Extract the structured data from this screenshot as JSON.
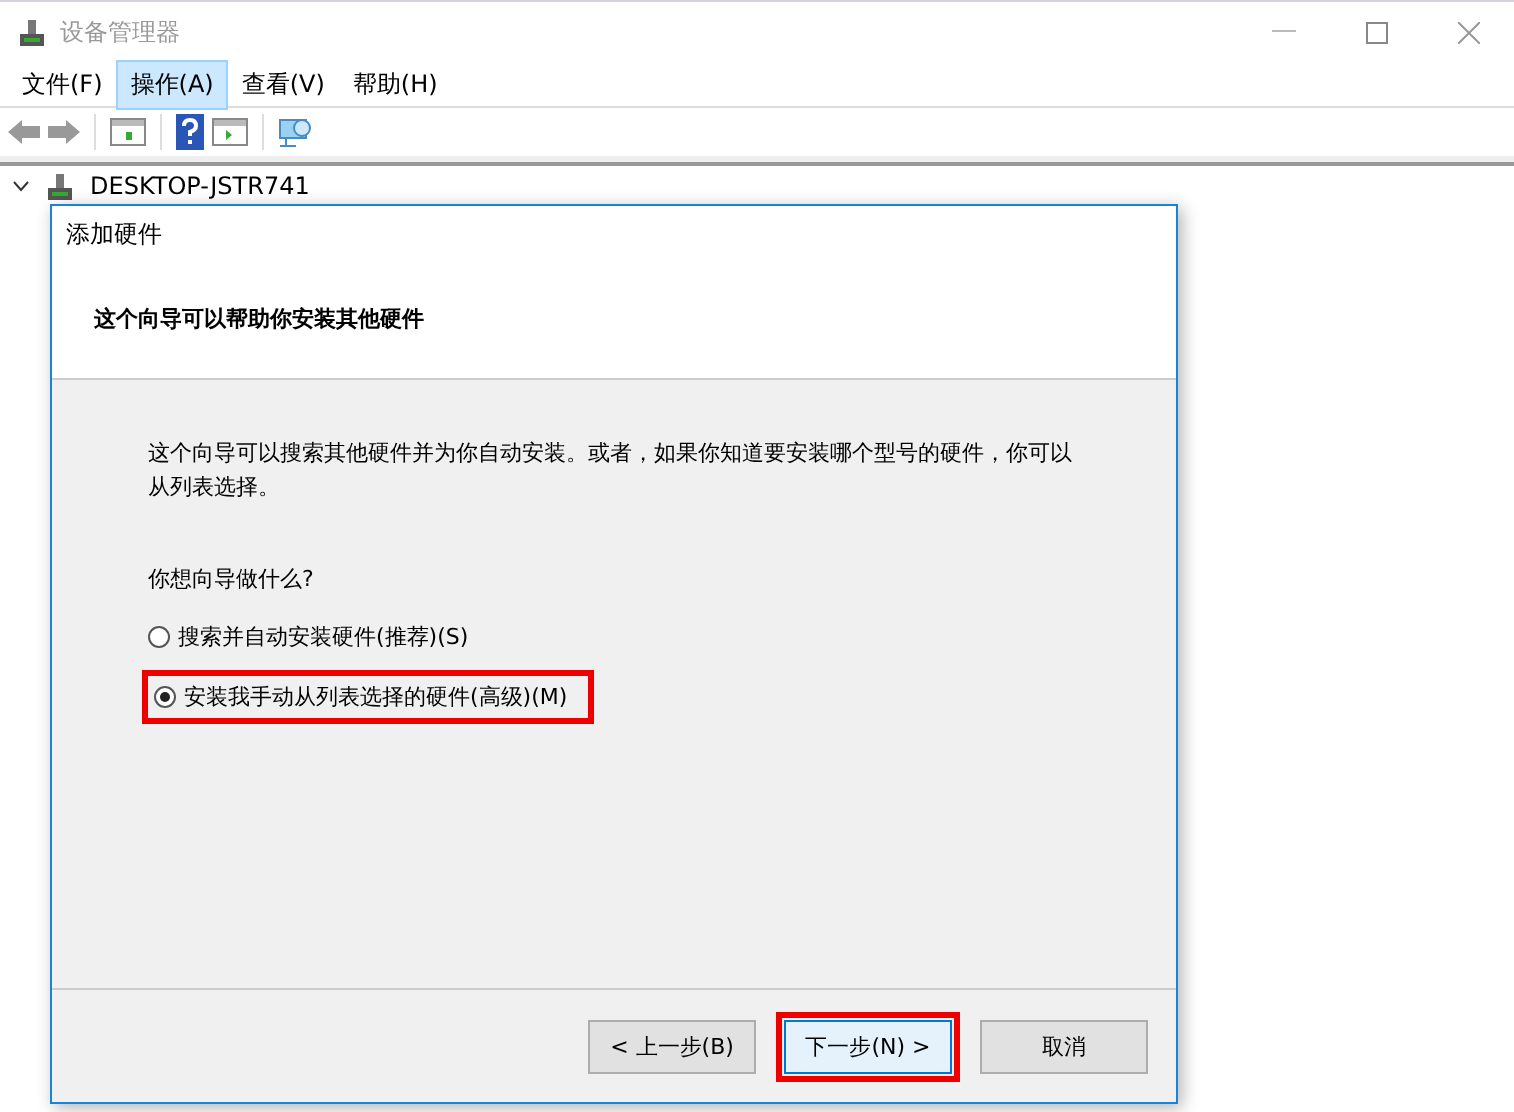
{
  "window": {
    "title": "设备管理器"
  },
  "menu": [
    {
      "label": "文件(F)",
      "selected": false
    },
    {
      "label": "操作(A)",
      "selected": true
    },
    {
      "label": "查看(V)",
      "selected": false
    },
    {
      "label": "帮助(H)",
      "selected": false
    }
  ],
  "tree": {
    "root": "DESKTOP-JSTR741",
    "expanded": true
  },
  "dialog": {
    "title": "添加硬件",
    "heading": "这个向导可以帮助你安装其他硬件",
    "intro": "这个向导可以搜索其他硬件并为你自动安装。或者，如果你知道要安装哪个型号的硬件，你可以从列表选择。",
    "question": "你想向导做什么?",
    "options": [
      {
        "label": "搜索并自动安装硬件(推荐)(S)",
        "selected": false,
        "highlighted": false
      },
      {
        "label": "安装我手动从列表选择的硬件(高级)(M)",
        "selected": true,
        "highlighted": true
      }
    ],
    "buttons": [
      {
        "label": "< 上一步(B)",
        "focused": false,
        "highlighted": false
      },
      {
        "label": "下一步(N) >",
        "focused": true,
        "highlighted": true
      },
      {
        "label": "取消",
        "focused": false,
        "highlighted": false
      }
    ]
  }
}
